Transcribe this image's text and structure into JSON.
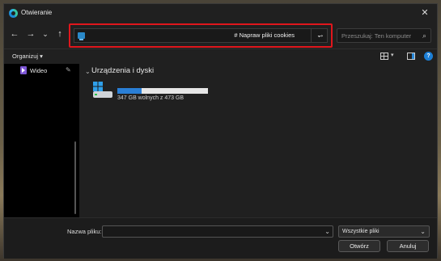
{
  "window": {
    "title": "Otwieranie",
    "close_glyph": "✕"
  },
  "nav": {
    "back_glyph": "←",
    "forward_glyph": "→",
    "recent_glyph": "⌄",
    "up_glyph": "↑",
    "address_path": "# Napraw pliki cookies",
    "address_caret": "⌄",
    "go_glyph": "→",
    "search_placeholder": "Przeszukaj: Ten komputer",
    "search_icon": "⌕"
  },
  "toolbar": {
    "organize_label": "Organizuj ▾",
    "view_caret": "▾",
    "help_label": "?"
  },
  "sidebar": {
    "items": [
      {
        "label": "Wideo",
        "icon": "video-icon",
        "pinned": true
      }
    ],
    "pin_glyph": "📌"
  },
  "main": {
    "group_caret": "⌄",
    "group_title": "Urządzenia i dyski",
    "drive": {
      "space_text": "347 GB wolnych z 473 GB",
      "used_fraction": 0.27
    }
  },
  "bottom": {
    "filename_label": "Nazwa pliku:",
    "filename_value": "",
    "filename_caret": "⌄",
    "filetype_value": "Wszystkie pliki",
    "filetype_caret": "⌄",
    "open_label": "Otwórz",
    "cancel_label": "Anuluj"
  },
  "colors": {
    "highlight_border": "#e0161c",
    "accent": "#2a7fd6",
    "window_bg": "#202020"
  }
}
